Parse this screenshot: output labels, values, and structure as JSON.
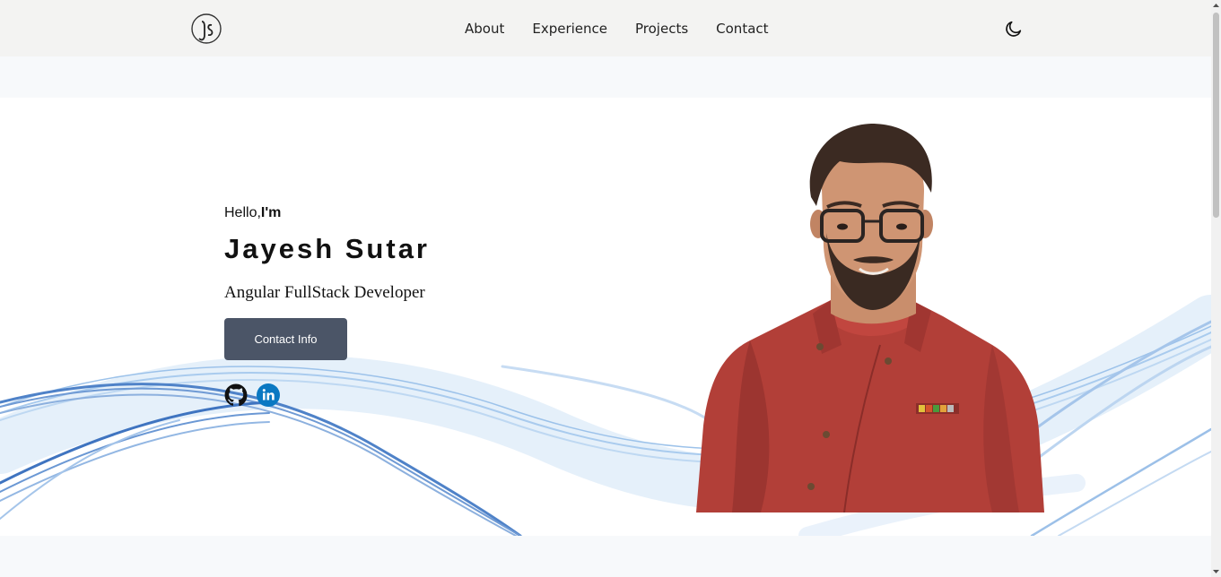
{
  "nav": {
    "logo_icon": "js-monogram-logo",
    "links": [
      "About",
      "Experience",
      "Projects",
      "Contact"
    ],
    "theme_icon": "moon-icon"
  },
  "hero": {
    "greeting": "Hello,",
    "greeting_bold": "I'm",
    "name": "Jayesh Sutar",
    "role": "Angular FullStack Developer",
    "cta_label": "Contact Info",
    "socials": [
      {
        "icon": "github-icon",
        "color": "#111111"
      },
      {
        "icon": "linkedin-icon",
        "color": "#0a66c2"
      }
    ],
    "portrait": "profile-photo",
    "accent_wave_color": "#5b8fd6"
  },
  "colors": {
    "nav_bg": "#f3f3f2",
    "page_bg": "#f7f9fb",
    "button_bg": "#4b5567"
  }
}
